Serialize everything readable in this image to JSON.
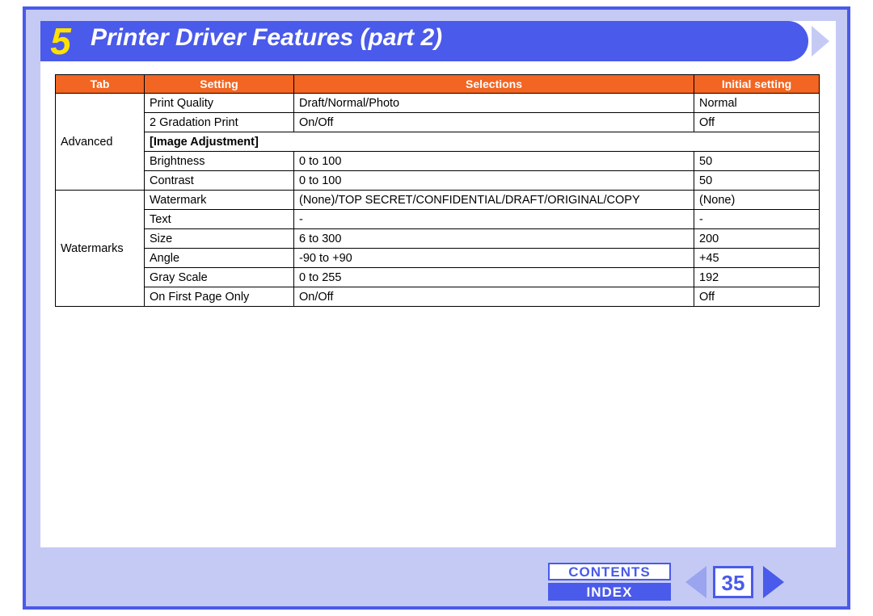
{
  "section_number": "5",
  "title": "Printer Driver Features (part 2)",
  "page_number": "35",
  "nav": {
    "contents": "CONTENTS",
    "index": "INDEX"
  },
  "table": {
    "headers": {
      "tab": "Tab",
      "setting": "Setting",
      "selections": "Selections",
      "initial": "Initial setting"
    },
    "groups": [
      {
        "tab": "Advanced",
        "rows": [
          {
            "setting": "Print Quality",
            "selections": "Draft/Normal/Photo",
            "initial": "Normal"
          },
          {
            "setting": "2 Gradation Print",
            "selections": "On/Off",
            "initial": "Off"
          },
          {
            "subheading": "[Image Adjustment]"
          },
          {
            "setting": "Brightness",
            "selections": "0 to 100",
            "initial": "50"
          },
          {
            "setting": "Contrast",
            "selections": "0 to 100",
            "initial": "50"
          }
        ]
      },
      {
        "tab": "Watermarks",
        "rows": [
          {
            "setting": "Watermark",
            "selections": "(None)/TOP SECRET/CONFIDENTIAL/DRAFT/ORIGINAL/COPY",
            "initial": "(None)"
          },
          {
            "setting": "Text",
            "selections": "-",
            "initial": "-"
          },
          {
            "setting": "Size",
            "selections": "6 to 300",
            "initial": "200"
          },
          {
            "setting": "Angle",
            "selections": "-90 to +90",
            "initial": "+45"
          },
          {
            "setting": "Gray Scale",
            "selections": "0 to 255",
            "initial": "192"
          },
          {
            "setting": "On First Page Only",
            "selections": "On/Off",
            "initial": "Off"
          }
        ]
      }
    ]
  }
}
